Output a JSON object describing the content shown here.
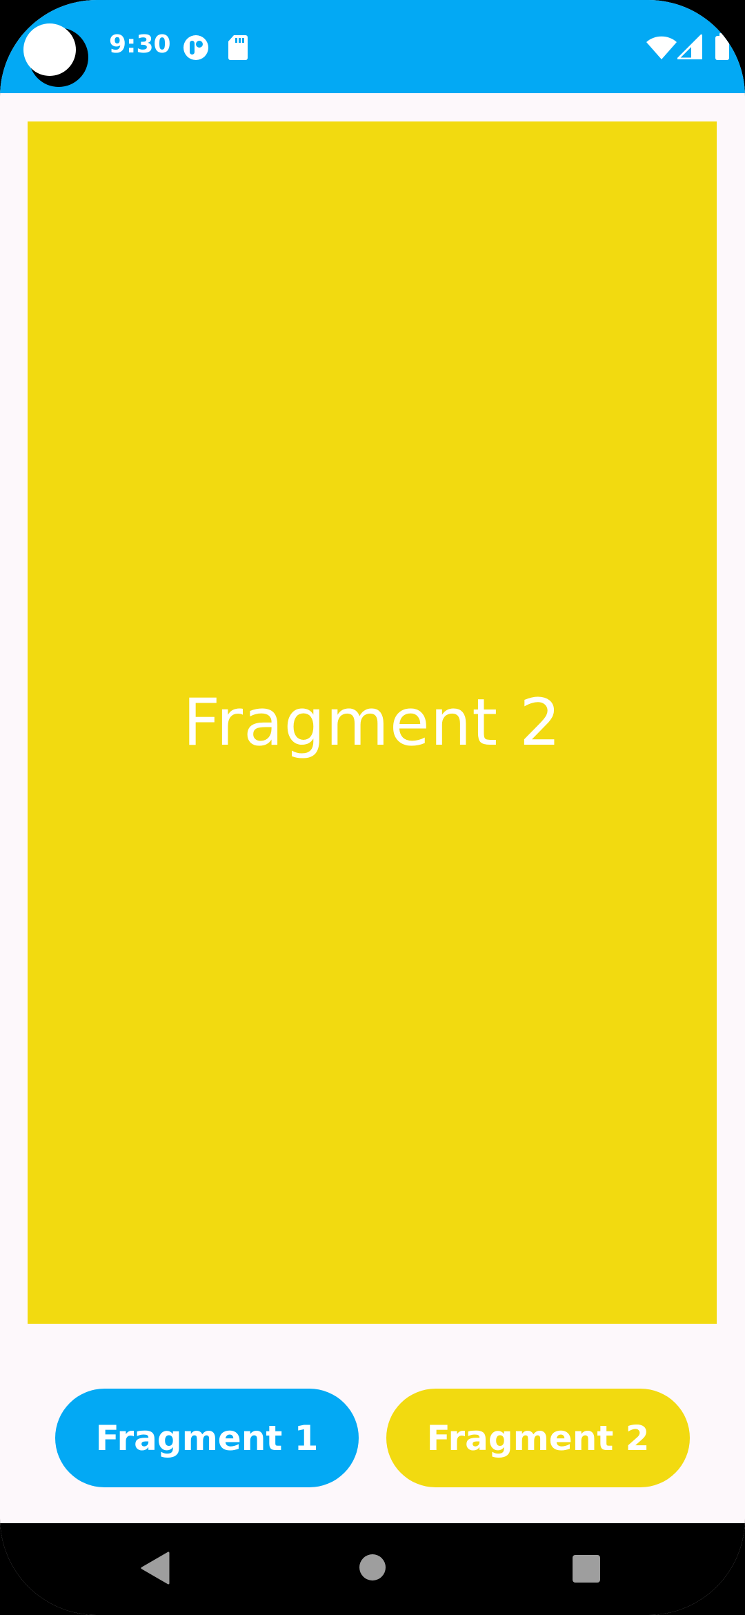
{
  "status_bar": {
    "time": "9:30",
    "background": "#03a9f4",
    "icons_left": [
      "notification-app-icon",
      "sd-card-icon"
    ],
    "icons_right": [
      "wifi-icon",
      "cellular-signal-icon",
      "battery-icon"
    ]
  },
  "fragment": {
    "label": "Fragment 2",
    "background": "#f2da10"
  },
  "buttons": {
    "fragment1_label": "Fragment 1",
    "fragment1_color": "#03a9f4",
    "fragment2_label": "Fragment 2",
    "fragment2_color": "#f2da10"
  },
  "nav_bar": {
    "icons": [
      "back-icon",
      "home-icon",
      "recents-icon"
    ]
  }
}
